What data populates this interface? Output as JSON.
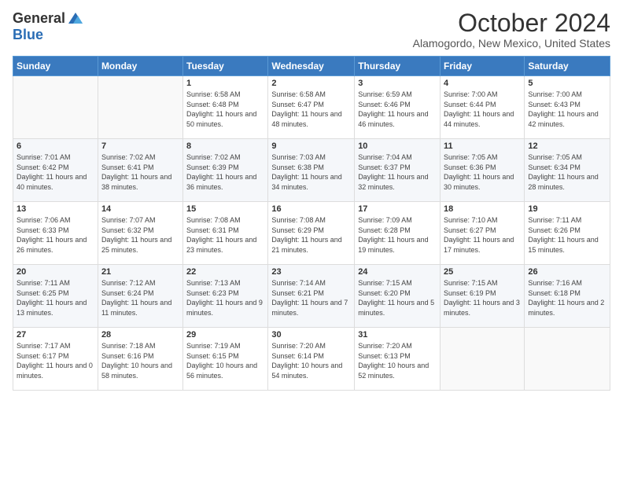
{
  "logo": {
    "general": "General",
    "blue": "Blue"
  },
  "title": "October 2024",
  "location": "Alamogordo, New Mexico, United States",
  "days_of_week": [
    "Sunday",
    "Monday",
    "Tuesday",
    "Wednesday",
    "Thursday",
    "Friday",
    "Saturday"
  ],
  "weeks": [
    [
      {
        "day": "",
        "sunrise": "",
        "sunset": "",
        "daylight": ""
      },
      {
        "day": "",
        "sunrise": "",
        "sunset": "",
        "daylight": ""
      },
      {
        "day": "1",
        "sunrise": "Sunrise: 6:58 AM",
        "sunset": "Sunset: 6:48 PM",
        "daylight": "Daylight: 11 hours and 50 minutes."
      },
      {
        "day": "2",
        "sunrise": "Sunrise: 6:58 AM",
        "sunset": "Sunset: 6:47 PM",
        "daylight": "Daylight: 11 hours and 48 minutes."
      },
      {
        "day": "3",
        "sunrise": "Sunrise: 6:59 AM",
        "sunset": "Sunset: 6:46 PM",
        "daylight": "Daylight: 11 hours and 46 minutes."
      },
      {
        "day": "4",
        "sunrise": "Sunrise: 7:00 AM",
        "sunset": "Sunset: 6:44 PM",
        "daylight": "Daylight: 11 hours and 44 minutes."
      },
      {
        "day": "5",
        "sunrise": "Sunrise: 7:00 AM",
        "sunset": "Sunset: 6:43 PM",
        "daylight": "Daylight: 11 hours and 42 minutes."
      }
    ],
    [
      {
        "day": "6",
        "sunrise": "Sunrise: 7:01 AM",
        "sunset": "Sunset: 6:42 PM",
        "daylight": "Daylight: 11 hours and 40 minutes."
      },
      {
        "day": "7",
        "sunrise": "Sunrise: 7:02 AM",
        "sunset": "Sunset: 6:41 PM",
        "daylight": "Daylight: 11 hours and 38 minutes."
      },
      {
        "day": "8",
        "sunrise": "Sunrise: 7:02 AM",
        "sunset": "Sunset: 6:39 PM",
        "daylight": "Daylight: 11 hours and 36 minutes."
      },
      {
        "day": "9",
        "sunrise": "Sunrise: 7:03 AM",
        "sunset": "Sunset: 6:38 PM",
        "daylight": "Daylight: 11 hours and 34 minutes."
      },
      {
        "day": "10",
        "sunrise": "Sunrise: 7:04 AM",
        "sunset": "Sunset: 6:37 PM",
        "daylight": "Daylight: 11 hours and 32 minutes."
      },
      {
        "day": "11",
        "sunrise": "Sunrise: 7:05 AM",
        "sunset": "Sunset: 6:36 PM",
        "daylight": "Daylight: 11 hours and 30 minutes."
      },
      {
        "day": "12",
        "sunrise": "Sunrise: 7:05 AM",
        "sunset": "Sunset: 6:34 PM",
        "daylight": "Daylight: 11 hours and 28 minutes."
      }
    ],
    [
      {
        "day": "13",
        "sunrise": "Sunrise: 7:06 AM",
        "sunset": "Sunset: 6:33 PM",
        "daylight": "Daylight: 11 hours and 26 minutes."
      },
      {
        "day": "14",
        "sunrise": "Sunrise: 7:07 AM",
        "sunset": "Sunset: 6:32 PM",
        "daylight": "Daylight: 11 hours and 25 minutes."
      },
      {
        "day": "15",
        "sunrise": "Sunrise: 7:08 AM",
        "sunset": "Sunset: 6:31 PM",
        "daylight": "Daylight: 11 hours and 23 minutes."
      },
      {
        "day": "16",
        "sunrise": "Sunrise: 7:08 AM",
        "sunset": "Sunset: 6:29 PM",
        "daylight": "Daylight: 11 hours and 21 minutes."
      },
      {
        "day": "17",
        "sunrise": "Sunrise: 7:09 AM",
        "sunset": "Sunset: 6:28 PM",
        "daylight": "Daylight: 11 hours and 19 minutes."
      },
      {
        "day": "18",
        "sunrise": "Sunrise: 7:10 AM",
        "sunset": "Sunset: 6:27 PM",
        "daylight": "Daylight: 11 hours and 17 minutes."
      },
      {
        "day": "19",
        "sunrise": "Sunrise: 7:11 AM",
        "sunset": "Sunset: 6:26 PM",
        "daylight": "Daylight: 11 hours and 15 minutes."
      }
    ],
    [
      {
        "day": "20",
        "sunrise": "Sunrise: 7:11 AM",
        "sunset": "Sunset: 6:25 PM",
        "daylight": "Daylight: 11 hours and 13 minutes."
      },
      {
        "day": "21",
        "sunrise": "Sunrise: 7:12 AM",
        "sunset": "Sunset: 6:24 PM",
        "daylight": "Daylight: 11 hours and 11 minutes."
      },
      {
        "day": "22",
        "sunrise": "Sunrise: 7:13 AM",
        "sunset": "Sunset: 6:23 PM",
        "daylight": "Daylight: 11 hours and 9 minutes."
      },
      {
        "day": "23",
        "sunrise": "Sunrise: 7:14 AM",
        "sunset": "Sunset: 6:21 PM",
        "daylight": "Daylight: 11 hours and 7 minutes."
      },
      {
        "day": "24",
        "sunrise": "Sunrise: 7:15 AM",
        "sunset": "Sunset: 6:20 PM",
        "daylight": "Daylight: 11 hours and 5 minutes."
      },
      {
        "day": "25",
        "sunrise": "Sunrise: 7:15 AM",
        "sunset": "Sunset: 6:19 PM",
        "daylight": "Daylight: 11 hours and 3 minutes."
      },
      {
        "day": "26",
        "sunrise": "Sunrise: 7:16 AM",
        "sunset": "Sunset: 6:18 PM",
        "daylight": "Daylight: 11 hours and 2 minutes."
      }
    ],
    [
      {
        "day": "27",
        "sunrise": "Sunrise: 7:17 AM",
        "sunset": "Sunset: 6:17 PM",
        "daylight": "Daylight: 11 hours and 0 minutes."
      },
      {
        "day": "28",
        "sunrise": "Sunrise: 7:18 AM",
        "sunset": "Sunset: 6:16 PM",
        "daylight": "Daylight: 10 hours and 58 minutes."
      },
      {
        "day": "29",
        "sunrise": "Sunrise: 7:19 AM",
        "sunset": "Sunset: 6:15 PM",
        "daylight": "Daylight: 10 hours and 56 minutes."
      },
      {
        "day": "30",
        "sunrise": "Sunrise: 7:20 AM",
        "sunset": "Sunset: 6:14 PM",
        "daylight": "Daylight: 10 hours and 54 minutes."
      },
      {
        "day": "31",
        "sunrise": "Sunrise: 7:20 AM",
        "sunset": "Sunset: 6:13 PM",
        "daylight": "Daylight: 10 hours and 52 minutes."
      },
      {
        "day": "",
        "sunrise": "",
        "sunset": "",
        "daylight": ""
      },
      {
        "day": "",
        "sunrise": "",
        "sunset": "",
        "daylight": ""
      }
    ]
  ]
}
